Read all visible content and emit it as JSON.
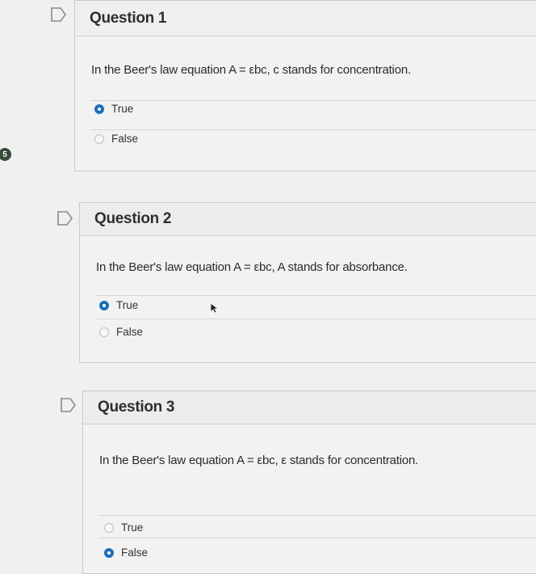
{
  "side_badge": "5",
  "questions": [
    {
      "title": "Question 1",
      "text": "In the Beer's law equation A = εbc, c stands for concentration.",
      "options": [
        {
          "label": "True",
          "selected": true
        },
        {
          "label": "False",
          "selected": false
        }
      ]
    },
    {
      "title": "Question 2",
      "text": "In the Beer's law equation A = εbc, A stands for absorbance.",
      "options": [
        {
          "label": "True",
          "selected": true
        },
        {
          "label": "False",
          "selected": false
        }
      ]
    },
    {
      "title": "Question 3",
      "text": "In the Beer's law equation A = εbc, ε stands for concentration.",
      "options": [
        {
          "label": "True",
          "selected": false
        },
        {
          "label": "False",
          "selected": true
        }
      ]
    }
  ],
  "colors": {
    "radio_selected": "#1b6fb8",
    "panel_bg": "#f2f2f2",
    "border": "#c9c9c9"
  },
  "icons": [
    "flag-icon",
    "cursor-arrow-icon"
  ]
}
